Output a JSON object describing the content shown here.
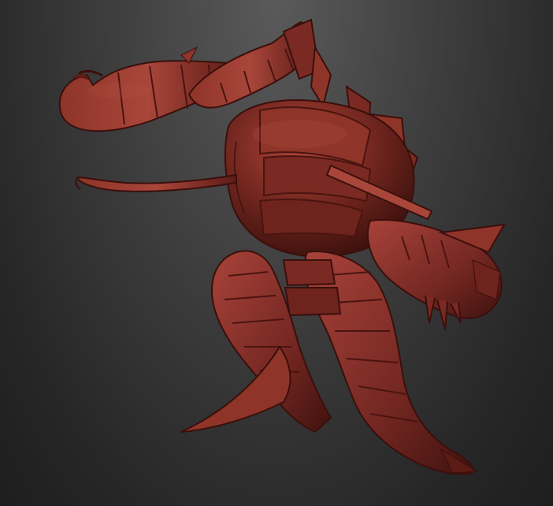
{
  "viewport": {
    "background_top": "#5a5a5a",
    "background_bottom": "#1e1e1e"
  },
  "model": {
    "material_color": "#7a2a22",
    "highlight_color": "#b0473b",
    "shadow_color": "#3a0f0c"
  }
}
